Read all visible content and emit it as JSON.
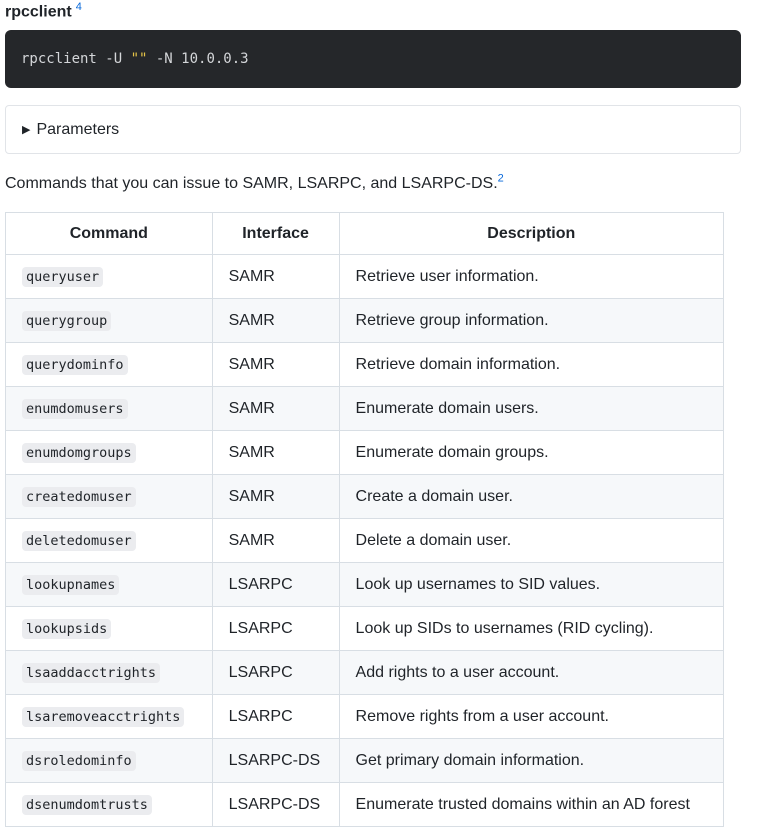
{
  "heading": {
    "title": "rpcclient",
    "footnote": "4"
  },
  "code_block": {
    "prefix": "rpcclient -U ",
    "string": "\"\"",
    "suffix": " -N 10.0.0.3"
  },
  "details": {
    "summary": "Parameters",
    "expanded": false
  },
  "intro": {
    "text": "Commands that you can issue to SAMR, LSARPC, and LSARPC-DS.",
    "footnote": "2"
  },
  "table": {
    "headers": [
      "Command",
      "Interface",
      "Description"
    ],
    "rows": [
      {
        "command": "queryuser",
        "interface": "SAMR",
        "description": "Retrieve user information."
      },
      {
        "command": "querygroup",
        "interface": "SAMR",
        "description": "Retrieve group information."
      },
      {
        "command": "querydominfo",
        "interface": "SAMR",
        "description": "Retrieve domain information."
      },
      {
        "command": "enumdomusers",
        "interface": "SAMR",
        "description": "Enumerate domain users."
      },
      {
        "command": "enumdomgroups",
        "interface": "SAMR",
        "description": "Enumerate domain groups."
      },
      {
        "command": "createdomuser",
        "interface": "SAMR",
        "description": "Create a domain user."
      },
      {
        "command": "deletedomuser",
        "interface": "SAMR",
        "description": "Delete a domain user."
      },
      {
        "command": "lookupnames",
        "interface": "LSARPC",
        "description": "Look up usernames to SID values."
      },
      {
        "command": "lookupsids",
        "interface": "LSARPC",
        "description": "Look up SIDs to usernames (RID cycling)."
      },
      {
        "command": "lsaaddacctrights",
        "interface": "LSARPC",
        "description": "Add rights to a user account."
      },
      {
        "command": "lsaremoveacctrights",
        "interface": "LSARPC",
        "description": "Remove rights from a user account."
      },
      {
        "command": "dsroledominfo",
        "interface": "LSARPC-DS",
        "description": "Get primary domain information."
      },
      {
        "command": "dsenumdomtrusts",
        "interface": "LSARPC-DS",
        "description": "Enumerate trusted domains within an AD forest"
      }
    ]
  },
  "colors": {
    "code_background": "#25272a",
    "code_text": "#d4d6d9",
    "code_string": "#e7c547",
    "link": "#0969da",
    "row_stripe": "#f6f8fa",
    "border": "#d8dee4"
  }
}
